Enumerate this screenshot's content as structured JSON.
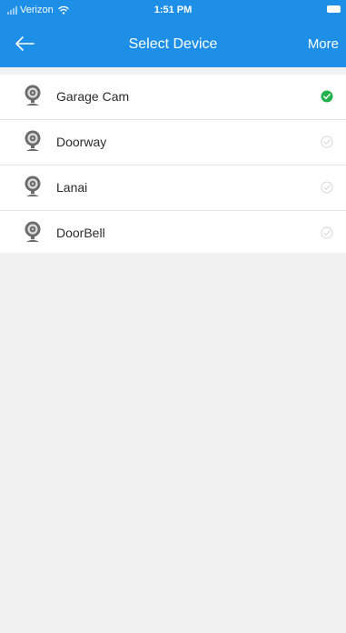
{
  "status_bar": {
    "carrier": "Verizon",
    "time": "1:51 PM"
  },
  "nav": {
    "title": "Select Device",
    "more_label": "More",
    "back_icon": "arrow-left-icon"
  },
  "devices": [
    {
      "name": "Garage Cam",
      "selected": true
    },
    {
      "name": "Doorway",
      "selected": false
    },
    {
      "name": "Lanai",
      "selected": false
    },
    {
      "name": "DoorBell",
      "selected": false
    }
  ],
  "colors": {
    "header": "#1e8fe6",
    "selected_check": "#22b24c",
    "unselected_check": "#d4d4d4",
    "background": "#f1f1f1",
    "row_text": "#2b2b2b"
  }
}
